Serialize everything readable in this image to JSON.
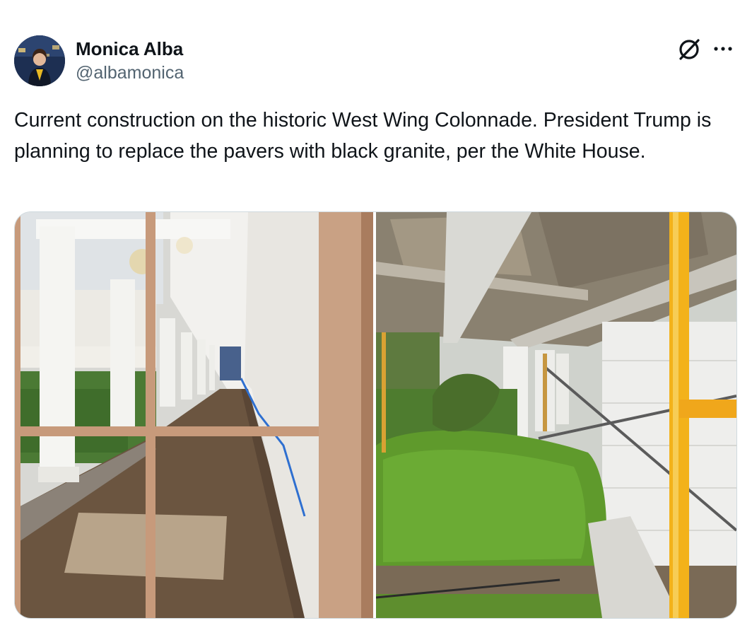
{
  "author": {
    "name": "Monica Alba",
    "handle": "@albamonica",
    "avatar_icon": "profile-photo"
  },
  "actions": {
    "grok_icon": "grok-icon",
    "more_icon": "more-icon"
  },
  "tweet": {
    "text": "Current construction on the historic West Wing Colonnade. President Trump is planning to replace the pavers with black granite, per the White House."
  },
  "media": {
    "photo_1": "photo",
    "photo_2": "photo"
  },
  "colors": {
    "text_primary": "#0f1419",
    "text_secondary": "#536471",
    "border": "#cfd9de"
  }
}
